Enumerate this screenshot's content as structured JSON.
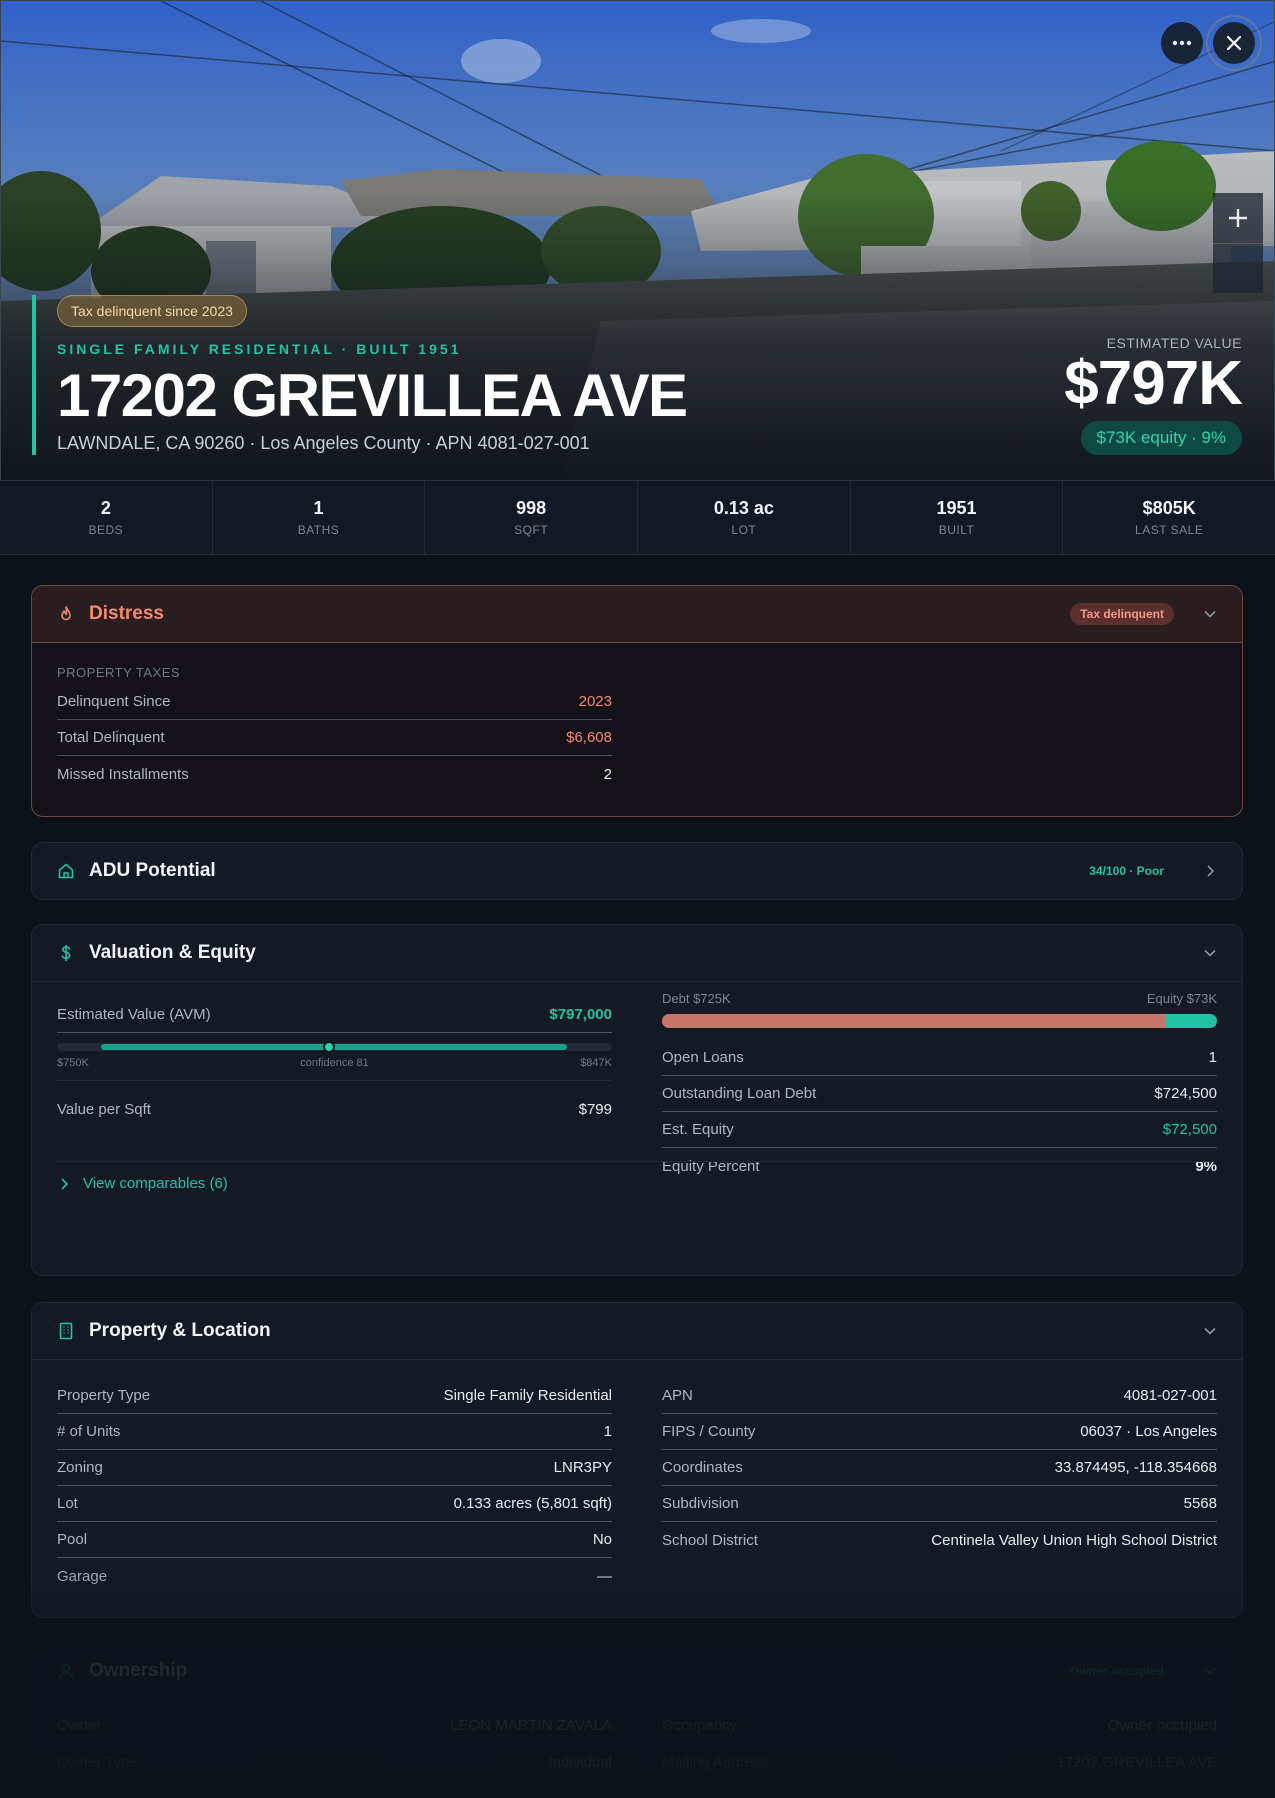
{
  "hero": {
    "badge": "Tax delinquent since 2023",
    "kicker": "SINGLE FAMILY RESIDENTIAL · BUILT 1951",
    "title": "17202 GREVILLEA AVE",
    "subtitle": "LAWNDALE, CA 90260 · Los Angeles County · APN 4081-027-001",
    "estimate_label": "ESTIMATED VALUE",
    "estimate_value": "$797K",
    "equity_pill": "$73K equity · 9%"
  },
  "stats": [
    {
      "value": "2",
      "label": "BEDS"
    },
    {
      "value": "1",
      "label": "BATHS"
    },
    {
      "value": "998",
      "label": "SQFT"
    },
    {
      "value": "0.13 ac",
      "label": "LOT"
    },
    {
      "value": "1951",
      "label": "BUILT"
    },
    {
      "value": "$805K",
      "label": "LAST SALE"
    }
  ],
  "distress": {
    "title": "Distress",
    "badge": "Tax delinquent",
    "section_label": "PROPERTY TAXES",
    "rows": [
      {
        "k": "Delinquent Since",
        "v": "2023"
      },
      {
        "k": "Total Delinquent",
        "v": "$6,608"
      },
      {
        "k": "Missed Installments",
        "v": "2"
      }
    ]
  },
  "adu": {
    "title": "ADU Potential",
    "badge": "34/100 · Poor"
  },
  "valuation": {
    "title": "Valuation & Equity",
    "avm_label": "Estimated Value (AVM)",
    "avm_value": "$797,000",
    "range_low": "$750K",
    "confidence": "confidence 81",
    "range_high": "$847K",
    "avm_fraction": 0.48,
    "value_per_sqft_label": "Value per Sqft",
    "value_per_sqft": "$799",
    "debt_label": "Debt $725K",
    "equity_label": "Equity $73K",
    "equity_fraction": 0.091,
    "rows": [
      {
        "k": "Open Loans",
        "v": "1"
      },
      {
        "k": "Outstanding Loan Debt",
        "v": "$724,500"
      },
      {
        "k": "Est. Equity",
        "v": "$72,500"
      },
      {
        "k": "Equity Percent",
        "v": "9%"
      }
    ],
    "comparables": "View comparables (6)"
  },
  "property": {
    "title": "Property & Location",
    "left": [
      {
        "k": "Property Type",
        "v": "Single Family Residential"
      },
      {
        "k": "# of Units",
        "v": "1"
      },
      {
        "k": "Zoning",
        "v": "LNR3PY"
      },
      {
        "k": "Lot",
        "v": "0.133 acres (5,801 sqft)"
      },
      {
        "k": "Pool",
        "v": "No"
      },
      {
        "k": "Garage",
        "v": "—"
      }
    ],
    "right": [
      {
        "k": "APN",
        "v": "4081-027-001"
      },
      {
        "k": "FIPS / County",
        "v": "06037 · Los Angeles"
      },
      {
        "k": "Coordinates",
        "v": "33.874495, -118.354668"
      },
      {
        "k": "Subdivision",
        "v": "5568"
      },
      {
        "k": "School District",
        "v": "Centinela Valley Union High School District"
      }
    ]
  },
  "ownership": {
    "title": "Ownership",
    "badge": "Owner-occupied",
    "left": [
      {
        "k": "Owner",
        "v": "LEON MARTIN ZAVALA"
      },
      {
        "k": "Owner Type",
        "v": "Individual"
      }
    ],
    "right": [
      {
        "k": "Occupancy",
        "v": "Owner-occupied"
      },
      {
        "k": "Mailing Address",
        "v": "17202 GREVILLEA AVE"
      }
    ]
  },
  "colors": {
    "accent": "#22c2a5",
    "distress": "#f08a72",
    "debt": "#c7766a"
  },
  "icons": [
    "more-icon",
    "close-icon",
    "plus-icon",
    "fire-icon",
    "home-icon",
    "dollar-icon",
    "building-icon",
    "user-icon",
    "chevron-down-icon",
    "chevron-right-icon"
  ]
}
